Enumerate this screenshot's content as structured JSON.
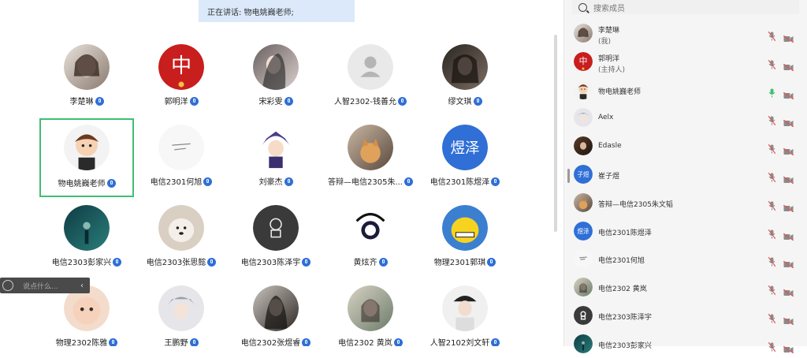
{
  "speaking_banner": "正在讲话: 物电姚巍老师;",
  "chat": {
    "placeholder": "说点什么..."
  },
  "members_panel": {
    "search_placeholder": "搜索成员"
  },
  "grid_tiles": [
    {
      "name": "李楚琳",
      "avatar": "photo-girl"
    },
    {
      "name": "郭明洋",
      "avatar": "red-china"
    },
    {
      "name": "宋彩雯",
      "avatar": "photo-woman"
    },
    {
      "name": "人智2302-钱善允",
      "avatar": "default-gray"
    },
    {
      "name": "缪文琪",
      "avatar": "photo-girl-dark"
    },
    {
      "name": "物电姚巍老师",
      "avatar": "cartoon-boy",
      "active": true
    },
    {
      "name": "电信2301何旭",
      "avatar": "white-sketch"
    },
    {
      "name": "刘豪杰",
      "avatar": "anime-purple"
    },
    {
      "name": "答辩—电信2305朱...",
      "avatar": "cat"
    },
    {
      "name": "电信2301陈煜泽",
      "avatar": "text-blue",
      "avatar_text": "煜泽"
    },
    {
      "name": "电信2303彭家兴",
      "avatar": "dark-teal"
    },
    {
      "name": "电信2303张思懿",
      "avatar": "dog"
    },
    {
      "name": "电信2303陈泽宇",
      "avatar": "astronaut"
    },
    {
      "name": "黄炫齐",
      "avatar": "astro-white"
    },
    {
      "name": "物理2301郭琪",
      "avatar": "yellow-cartoon"
    },
    {
      "name": "物理2302陈雅",
      "avatar": "baby"
    },
    {
      "name": "王鹏野",
      "avatar": "anime-boy"
    },
    {
      "name": "电信2302张煜睿",
      "avatar": "woman-dark"
    },
    {
      "name": "电信2302 黄岚",
      "avatar": "girl-painting"
    },
    {
      "name": "人智2102刘文轩",
      "avatar": "boy-hat"
    }
  ],
  "members": [
    {
      "name": "李楚琳",
      "role": "(我)",
      "avatar": "photo-girl",
      "mic": "muted"
    },
    {
      "name": "郭明洋",
      "role": "(主持人)",
      "avatar": "red-china",
      "mic": "muted"
    },
    {
      "name": "物电姚巍老师",
      "role": "",
      "avatar": "cartoon-boy",
      "mic": "active"
    },
    {
      "name": "Aelx",
      "role": "",
      "avatar": "anime-boy",
      "mic": "muted"
    },
    {
      "name": "Edasle",
      "role": "",
      "avatar": "photo-dark",
      "mic": "muted"
    },
    {
      "name": "崔子煜",
      "role": "",
      "avatar": "text-blue",
      "avatar_text": "子煜",
      "mic": "muted"
    },
    {
      "name": "答辩—电信2305朱文韬",
      "role": "",
      "avatar": "cat",
      "mic": "muted"
    },
    {
      "name": "电信2301陈煜泽",
      "role": "",
      "avatar": "text-blue",
      "avatar_text": "煜泽",
      "mic": "muted"
    },
    {
      "name": "电信2301何旭",
      "role": "",
      "avatar": "white-sketch",
      "mic": "muted"
    },
    {
      "name": "电信2302 黄岚",
      "role": "",
      "avatar": "girl-painting",
      "mic": "muted"
    },
    {
      "name": "电信2303陈泽宇",
      "role": "",
      "avatar": "astronaut",
      "mic": "muted"
    },
    {
      "name": "电信2303彭家兴",
      "role": "",
      "avatar": "dark-teal",
      "mic": "muted"
    }
  ],
  "colors": {
    "accent_blue": "#2f6fd6",
    "active_green": "#3fbf72",
    "muted_red": "#e05555"
  }
}
